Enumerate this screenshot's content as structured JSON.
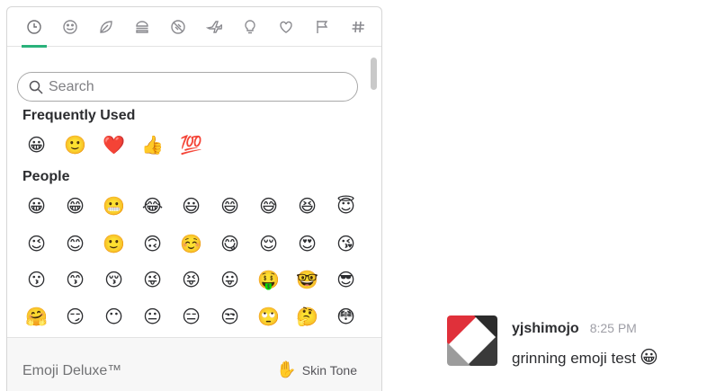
{
  "picker": {
    "tabs": [
      {
        "icon": "clock-icon",
        "active": true
      },
      {
        "icon": "smiley-icon"
      },
      {
        "icon": "leaf-icon"
      },
      {
        "icon": "burger-icon"
      },
      {
        "icon": "ball-icon"
      },
      {
        "icon": "airplane-icon"
      },
      {
        "icon": "lightbulb-icon"
      },
      {
        "icon": "heart-icon"
      },
      {
        "icon": "flag-icon"
      },
      {
        "icon": "hash-icon"
      }
    ],
    "search": {
      "placeholder": "Search",
      "value": ""
    },
    "frequently_used": {
      "title": "Frequently Used",
      "emojis": [
        "😀",
        "🙂",
        "❤️",
        "👍",
        "💯"
      ]
    },
    "people": {
      "title": "People",
      "rows": [
        [
          "😀",
          "😁",
          "😬",
          "😂",
          "😃",
          "😄",
          "😅",
          "😆",
          "😇"
        ],
        [
          "😉",
          "😊",
          "🙂",
          "🙃",
          "☺️",
          "😋",
          "😌",
          "😍",
          "😘"
        ],
        [
          "😗",
          "😙",
          "😚",
          "😜",
          "😝",
          "😛",
          "🤑",
          "🤓",
          "😎"
        ],
        [
          "🤗",
          "😏",
          "😶",
          "😐",
          "😑",
          "😒",
          "🙄",
          "🤔",
          "😳"
        ]
      ]
    },
    "footer": {
      "title": "Emoji Deluxe™",
      "skin_tone_label": "Skin Tone",
      "skin_tone_icon": "✋"
    },
    "accent_color": "#2ab27b"
  },
  "message": {
    "username": "yjshimojo",
    "timestamp": "8:25 PM",
    "text": "grinning emoji test",
    "emoji": "😀"
  }
}
